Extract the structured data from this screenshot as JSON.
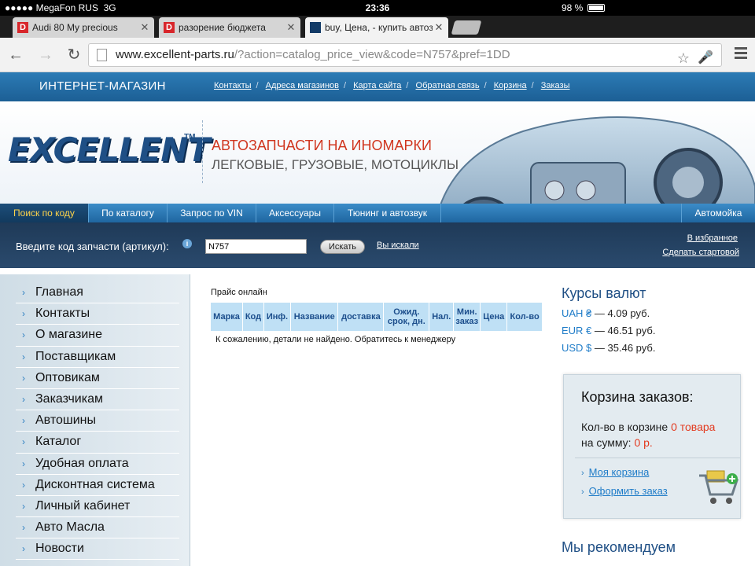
{
  "status": {
    "carrier": "MegaFon RUS",
    "network": "3G",
    "time": "23:36",
    "battery": "98 %"
  },
  "tabs": [
    {
      "title": "Audi 80 My precious",
      "favicon": "D"
    },
    {
      "title": "разорение бюджета",
      "favicon": "D"
    },
    {
      "title": "buy, Цена, - купить автоз",
      "favicon": ""
    }
  ],
  "url": {
    "host": "www.excellent-parts.ru",
    "path": "/?action=catalog_price_view&code=N757&pref=1DD"
  },
  "header": {
    "shop_label": "ИНТЕРНЕТ-МАГАЗИН",
    "links": [
      "Контакты",
      "Адреса магазинов",
      "Карта сайта",
      "Обратная связь",
      "Корзина",
      "Заказы"
    ]
  },
  "banner": {
    "logo": "EXCELLENT",
    "tm": "TM",
    "tagline1": "АВТОЗАПЧАСТИ НА ИНОМАРКИ",
    "tagline2": "ЛЕГКОВЫЕ, ГРУЗОВЫЕ, МОТОЦИКЛЫ"
  },
  "catalog_tabs": [
    "Поиск по коду",
    "По каталогу",
    "Запрос по VIN",
    "Аксессуары",
    "Тюнинг и автозвук",
    "Автомойка"
  ],
  "search": {
    "label": "Введите код запчасти (артикул):",
    "value": "N757",
    "button": "Искать",
    "history_link": "Вы искали",
    "favorites_link": "В избранное",
    "homepage_link": "Сделать стартовой"
  },
  "sidebar": {
    "items": [
      "Главная",
      "Контакты",
      "О магазине",
      "Поставщикам",
      "Оптовикам",
      "Заказчикам",
      "Автошины",
      "Каталог",
      "Удобная оплата",
      "Дисконтная система",
      "Личный кабинет",
      "Авто Масла",
      "Новости"
    ]
  },
  "price": {
    "title": "Прайс онлайн",
    "columns": [
      "Марка",
      "Код",
      "Инф.",
      "Название",
      "доставка",
      "Ожид. срок, дн.",
      "Нал.",
      "Мин. заказ",
      "Цена",
      "Кол-во"
    ],
    "empty_message": "К сожалению, детали не найдено. Обратитесь к менеджеру"
  },
  "rates": {
    "title": "Курсы валют",
    "items": [
      {
        "currency": "UAH ₴",
        "value": " — 4.09 руб."
      },
      {
        "currency": "EUR €",
        "value": " — 46.51 руб."
      },
      {
        "currency": "USD $",
        "value": " — 35.46 руб."
      }
    ]
  },
  "cart": {
    "title": "Корзина заказов:",
    "count_label": "Кол-во в корзине ",
    "count_value": "0 товара",
    "sum_label": "на сумму: ",
    "sum_value": "0 р.",
    "my_cart": "Моя корзина",
    "checkout": "Оформить заказ"
  },
  "recommend_title": "Мы рекомендуем"
}
